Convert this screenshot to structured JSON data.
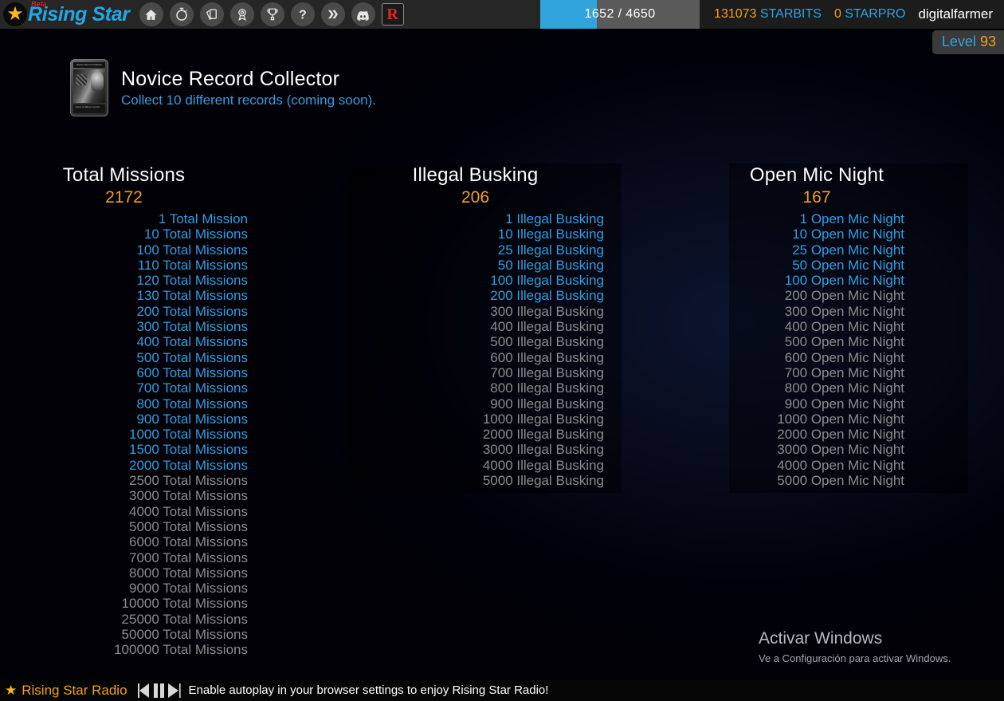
{
  "nav": {
    "brand": "Rising Star",
    "beta": "Beta",
    "icons": [
      {
        "name": "home-icon",
        "label": "Home"
      },
      {
        "name": "stopwatch-icon",
        "label": "Timer"
      },
      {
        "name": "cards-icon",
        "label": "Cards"
      },
      {
        "name": "award-ribbon-icon",
        "label": "Achievements"
      },
      {
        "name": "trophy-icon",
        "label": "Leaderboard"
      },
      {
        "name": "question-mark-icon",
        "label": "Help"
      },
      {
        "name": "hive-icon",
        "label": "Hive"
      },
      {
        "name": "discord-icon",
        "label": "Discord"
      },
      {
        "name": "rising-star-r-icon",
        "label": "R"
      }
    ]
  },
  "stats": {
    "progress_value": "1652 / 4650",
    "progress_current": 1652,
    "progress_max": 4650,
    "starbits_amount": "131073",
    "starbits_label": "STARBITS",
    "starpro_amount": "0",
    "starpro_label": "STARPRO",
    "username": "digitalfarmer",
    "level_word": "Level",
    "level_value": "93"
  },
  "achievement_banner": {
    "title": "Novice Record Collector",
    "subtitle": "Collect 10 different records (coming soon).",
    "card_title": "Novice Record Collector",
    "card_footer": "Collect 10 different records"
  },
  "colors": {
    "accent_orange": "#f0a020",
    "accent_blue": "#2f9fe0",
    "muted_gray": "#8d8d8d",
    "nav_bg": "#262626",
    "progress_fill": "#31a3dd"
  },
  "columns": [
    {
      "title": "Total Missions",
      "count": "2172",
      "items": [
        {
          "label": "1 Total Mission",
          "done": true
        },
        {
          "label": "10 Total Missions",
          "done": true
        },
        {
          "label": "100 Total Missions",
          "done": true
        },
        {
          "label": "110 Total Missions",
          "done": true
        },
        {
          "label": "120 Total Missions",
          "done": true
        },
        {
          "label": "130 Total Missions",
          "done": true
        },
        {
          "label": "200 Total Missions",
          "done": true
        },
        {
          "label": "300 Total Missions",
          "done": true
        },
        {
          "label": "400 Total Missions",
          "done": true
        },
        {
          "label": "500 Total Missions",
          "done": true
        },
        {
          "label": "600 Total Missions",
          "done": true
        },
        {
          "label": "700 Total Missions",
          "done": true
        },
        {
          "label": "800 Total Missions",
          "done": true
        },
        {
          "label": "900 Total Missions",
          "done": true
        },
        {
          "label": "1000 Total Missions",
          "done": true
        },
        {
          "label": "1500 Total Missions",
          "done": true
        },
        {
          "label": "2000 Total Missions",
          "done": true
        },
        {
          "label": "2500 Total Missions",
          "done": false
        },
        {
          "label": "3000 Total Missions",
          "done": false
        },
        {
          "label": "4000 Total Missions",
          "done": false
        },
        {
          "label": "5000 Total Missions",
          "done": false
        },
        {
          "label": "6000 Total Missions",
          "done": false
        },
        {
          "label": "7000 Total Missions",
          "done": false
        },
        {
          "label": "8000 Total Missions",
          "done": false
        },
        {
          "label": "9000 Total Missions",
          "done": false
        },
        {
          "label": "10000 Total Missions",
          "done": false
        },
        {
          "label": "25000 Total Missions",
          "done": false
        },
        {
          "label": "50000 Total Missions",
          "done": false
        },
        {
          "label": "100000 Total Missions",
          "done": false
        }
      ]
    },
    {
      "title": "Illegal Busking",
      "count": "206",
      "items": [
        {
          "label": "1 Illegal Busking",
          "done": true
        },
        {
          "label": "10 Illegal Busking",
          "done": true
        },
        {
          "label": "25 Illegal Busking",
          "done": true
        },
        {
          "label": "50 Illegal Busking",
          "done": true
        },
        {
          "label": "100 Illegal Busking",
          "done": true
        },
        {
          "label": "200 Illegal Busking",
          "done": true
        },
        {
          "label": "300 Illegal Busking",
          "done": false
        },
        {
          "label": "400 Illegal Busking",
          "done": false
        },
        {
          "label": "500 Illegal Busking",
          "done": false
        },
        {
          "label": "600 Illegal Busking",
          "done": false
        },
        {
          "label": "700 Illegal Busking",
          "done": false
        },
        {
          "label": "800 Illegal Busking",
          "done": false
        },
        {
          "label": "900 Illegal Busking",
          "done": false
        },
        {
          "label": "1000 Illegal Busking",
          "done": false
        },
        {
          "label": "2000 Illegal Busking",
          "done": false
        },
        {
          "label": "3000 Illegal Busking",
          "done": false
        },
        {
          "label": "4000 Illegal Busking",
          "done": false
        },
        {
          "label": "5000 Illegal Busking",
          "done": false
        }
      ]
    },
    {
      "title": "Open Mic Night",
      "count": "167",
      "items": [
        {
          "label": "1 Open Mic Night",
          "done": true
        },
        {
          "label": "10 Open Mic Night",
          "done": true
        },
        {
          "label": "25 Open Mic Night",
          "done": true
        },
        {
          "label": "50 Open Mic Night",
          "done": true
        },
        {
          "label": "100 Open Mic Night",
          "done": true
        },
        {
          "label": "200 Open Mic Night",
          "done": false
        },
        {
          "label": "300 Open Mic Night",
          "done": false
        },
        {
          "label": "400 Open Mic Night",
          "done": false
        },
        {
          "label": "500 Open Mic Night",
          "done": false
        },
        {
          "label": "600 Open Mic Night",
          "done": false
        },
        {
          "label": "700 Open Mic Night",
          "done": false
        },
        {
          "label": "800 Open Mic Night",
          "done": false
        },
        {
          "label": "900 Open Mic Night",
          "done": false
        },
        {
          "label": "1000 Open Mic Night",
          "done": false
        },
        {
          "label": "2000 Open Mic Night",
          "done": false
        },
        {
          "label": "3000 Open Mic Night",
          "done": false
        },
        {
          "label": "4000 Open Mic Night",
          "done": false
        },
        {
          "label": "5000 Open Mic Night",
          "done": false
        }
      ]
    }
  ],
  "watermark": {
    "line1": "Activar Windows",
    "line2": "Ve a Configuración para activar Windows."
  },
  "radio": {
    "name": "Rising Star Radio",
    "message": "Enable autoplay in your browser settings to enjoy Rising Star Radio!",
    "controls": [
      {
        "name": "previous-track-button"
      },
      {
        "name": "pause-button"
      },
      {
        "name": "next-track-button"
      }
    ]
  }
}
